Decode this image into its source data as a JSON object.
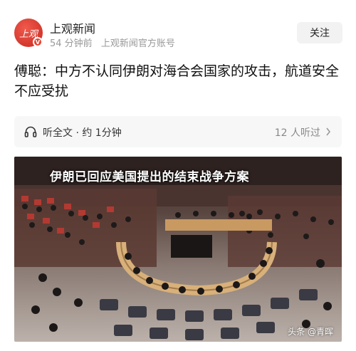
{
  "account": {
    "avatar_text": "上观",
    "name": "上观新闻",
    "time": "54 分钟前",
    "description": "上观新闻官方账号",
    "follow_label": "关注"
  },
  "article": {
    "headline": "傅聪：中方不认同伊朗对海合会国家的攻击，航道安全不应受扰"
  },
  "listen": {
    "label": "听全文 · 约 1分钟",
    "count": "12 人听过",
    "icon": "headphones-icon"
  },
  "photo": {
    "caption": "伊朗已回应美国提出的结束战争方案",
    "watermark": "头条 @青晖"
  },
  "colors": {
    "brand_red": "#e8412f",
    "meta_gray": "#999999"
  }
}
